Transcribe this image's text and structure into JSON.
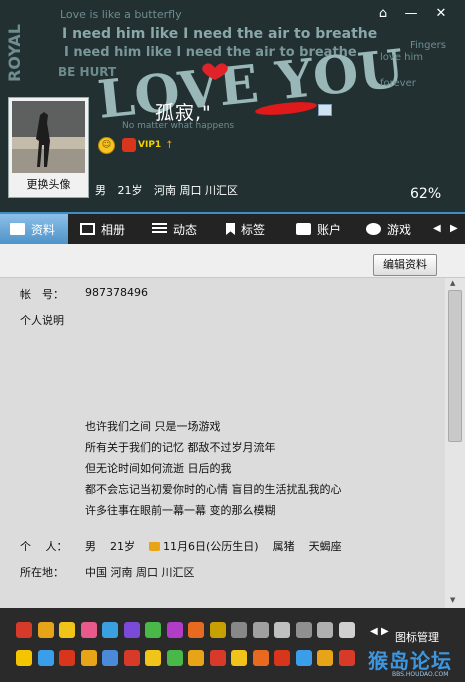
{
  "window_controls": {
    "pin_icon": "pin-icon",
    "minimize": "—",
    "close": "✕"
  },
  "banner": {
    "bg_text_lines": [
      "Love is like a butterfly",
      "I need him like I need the air to breathe",
      "I need him like I need the air to breathe",
      "BE HURT",
      "LOVE YOU",
      "No matter what happens",
      "love him",
      "Fingers",
      "forever",
      "ROYAL"
    ],
    "avatar_button": "更换头像",
    "nickname": "孤寂,\"",
    "vip_label": "VIP1",
    "vip_up": "↑",
    "gender": "男",
    "age": "21岁",
    "location": "河南 周口 川汇区",
    "percent": "62%"
  },
  "tabs": [
    {
      "label": "资料",
      "icon": "profile-card-icon",
      "active": true
    },
    {
      "label": "相册",
      "icon": "photo-album-icon",
      "active": false
    },
    {
      "label": "动态",
      "icon": "feed-list-icon",
      "active": false
    },
    {
      "label": "标签",
      "icon": "bookmark-icon",
      "active": false
    },
    {
      "label": "账户",
      "icon": "wallet-icon",
      "active": false
    },
    {
      "label": "游戏",
      "icon": "game-icon",
      "active": false
    }
  ],
  "edit_button": "编辑资料",
  "profile": {
    "account_label": "帐　号：",
    "account_value": "987378496",
    "description_label": "个人说明",
    "signature_lines": [
      "也许我们之间 只是一场游戏",
      "所有关于我们的记忆 都敌不过岁月流年",
      "但无论时间如何流逝 日后的我",
      "都不会忘记当初爱你时的心情 盲目的生活扰乱我的心",
      "许多往事在眼前一幕一幕 变的那么模糊"
    ],
    "personal_label": "个　 人：",
    "gender": "男",
    "age": "21岁",
    "birthday": "11月6日(公历生日)",
    "zodiac": "属猪",
    "constellation": "天蝎座",
    "address_label": "所在地：",
    "address_value": "中国 河南 周口 川汇区"
  },
  "icon_strip": {
    "manage_label": "图标管理",
    "watermark": "猴岛论坛",
    "watermark_sub": "BBS.HOUDAO.COM",
    "colors": [
      "#d83a2a",
      "#e8a418",
      "#f0c419",
      "#e85a8c",
      "#3aa0e0",
      "#7b4ad8",
      "#4ab848",
      "#b03cc8",
      "#e86a20",
      "#c8a000",
      "#888888",
      "#a0a0a0",
      "#c0c0c0",
      "#909090",
      "#b0b0b0",
      "#d0d0d0",
      "#f5c400",
      "#3a9ee8",
      "#d8361c",
      "#e8a418",
      "#4a8ad8",
      "#d83a2a",
      "#f0c419",
      "#4ab848",
      "#e8a418",
      "#d83a2a",
      "#f0c419",
      "#e86a20",
      "#d8361c",
      "#3a9ee8",
      "#e8a418",
      "#d83a2a"
    ]
  }
}
